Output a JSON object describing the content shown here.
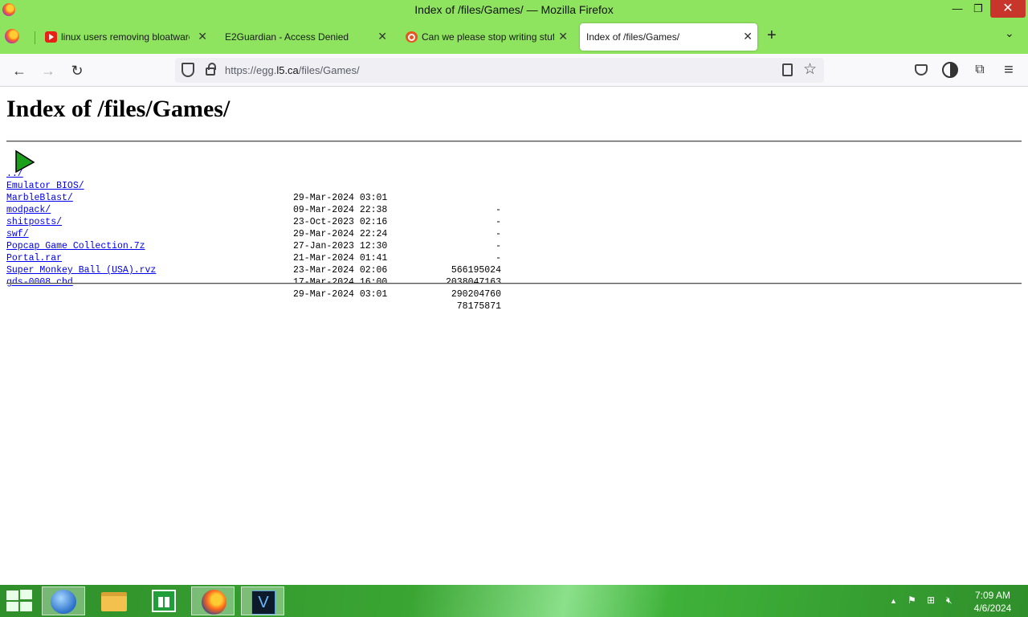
{
  "window": {
    "title": "Index of /files/Games/ — Mozilla Firefox",
    "minimize_label": "—",
    "maximize_label": "❐",
    "close_label": "✕"
  },
  "tabs": [
    {
      "label": "linux users removing bloatware",
      "icon": "youtube-icon",
      "close": "✕"
    },
    {
      "label": "E2Guardian - Access Denied",
      "icon": "",
      "close": "✕"
    },
    {
      "label": "Can we please stop writing stuff",
      "icon": "ubuntu-icon",
      "close": "✕"
    },
    {
      "label": "Index of /files/Games/",
      "icon": "",
      "close": "✕",
      "active": true
    }
  ],
  "toolbar": {
    "new_tab": "+",
    "tab_list": "⌄",
    "back": "←",
    "forward": "→",
    "reload": "↻",
    "menu": "≡",
    "extensions": "⧉"
  },
  "urlbar": {
    "prefix": "https://egg.",
    "host": "l5.ca",
    "path": "/files/Games/",
    "star": "☆"
  },
  "page": {
    "heading": "Index of /files/Games/",
    "parent_link": "../",
    "entries": [
      {
        "name": "Emulator BIOS/",
        "date": "29-Mar-2024 03:01",
        "size": "-"
      },
      {
        "name": "MarbleBlast/",
        "date": "09-Mar-2024 22:38",
        "size": "-"
      },
      {
        "name": "modpack/",
        "date": "23-Oct-2023 02:16",
        "size": "-"
      },
      {
        "name": "shitposts/",
        "date": "29-Mar-2024 22:24",
        "size": "-"
      },
      {
        "name": "swf/",
        "date": "27-Jan-2023 12:30",
        "size": "-"
      },
      {
        "name": "Popcap Game Collection.7z",
        "date": "21-Mar-2024 01:41",
        "size": "566195024"
      },
      {
        "name": "Portal.rar",
        "date": "23-Mar-2024 02:06",
        "size": "2038047163"
      },
      {
        "name": "Super Monkey Ball (USA).rvz",
        "date": "17-Mar-2024 16:00",
        "size": "290204760"
      },
      {
        "name": "gds-0008.chd",
        "date": "29-Mar-2024 03:01",
        "size": "78175871"
      }
    ]
  },
  "taskbar": {
    "apps": [
      "globe-icon",
      "file-explorer-icon",
      "store-icon",
      "firefox-icon",
      "v-app-icon"
    ],
    "v_label": "V",
    "tray_arrow": "▲",
    "time": "7:09 AM",
    "date": "4/6/2024"
  }
}
